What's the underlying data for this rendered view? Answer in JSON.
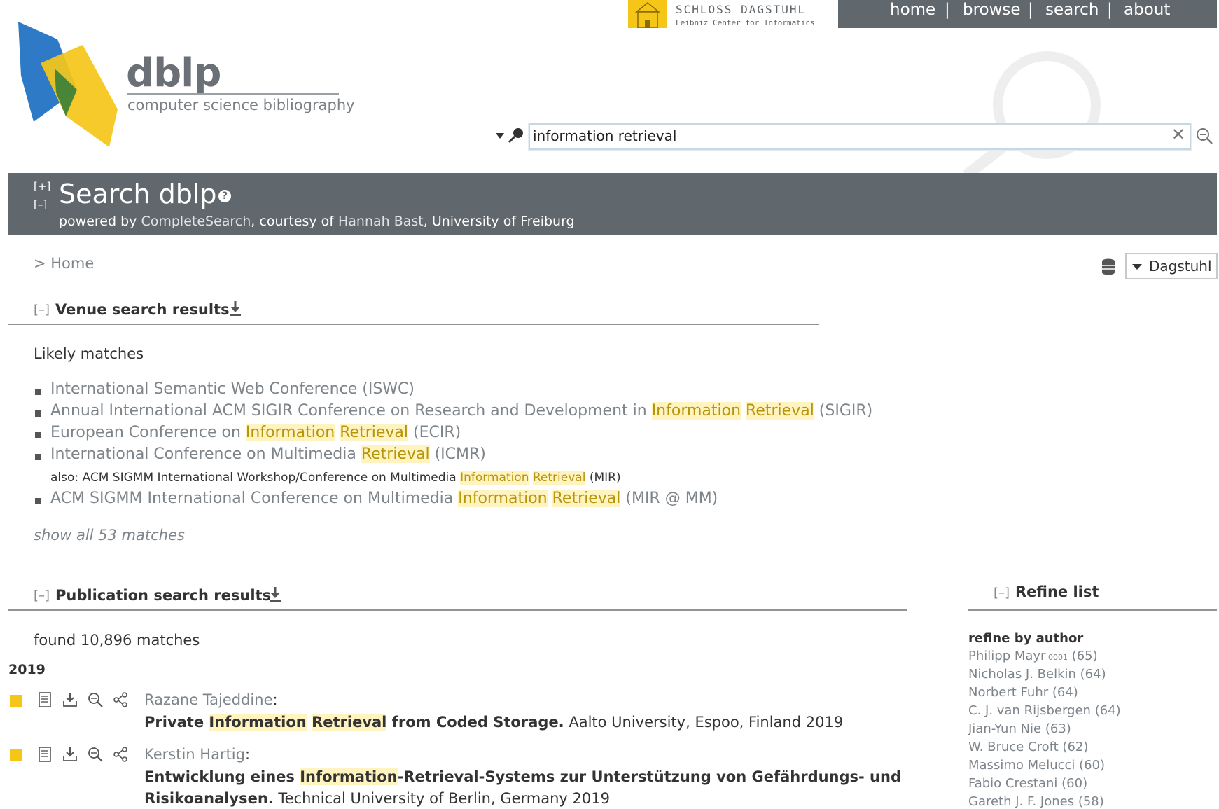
{
  "nav": {
    "home": "home",
    "browse": "browse",
    "search": "search",
    "about": "about",
    "sep": "|"
  },
  "dagstuhl": {
    "line1": "SCHLOSS DAGSTUHL",
    "line2": "Leibniz Center for Informatics"
  },
  "logo": {
    "name": "dblp",
    "tagline": "computer science bibliography"
  },
  "search": {
    "query": "information retrieval",
    "clear": "✕"
  },
  "header": {
    "expand": "[+]",
    "collapse": "[–]",
    "title": "Search dblp",
    "help": "?",
    "powered_by": "powered by ",
    "completesearch": "CompleteSearch",
    "courtesy": ", courtesy of ",
    "person": "Hannah Bast",
    "affiliation": ", University of Freiburg"
  },
  "breadcrumb": "> Home",
  "mirror": {
    "selected": "Dagstuhl"
  },
  "venue": {
    "toggle": "[–]",
    "title": "Venue search results",
    "likely": "Likely matches",
    "items": [
      {
        "parts": [
          {
            "t": "International Semantic Web Conference (ISWC)"
          }
        ]
      },
      {
        "parts": [
          {
            "t": "Annual International ACM SIGIR Conference on Research and Development in "
          },
          {
            "t": "Information",
            "h": true
          },
          {
            "t": " "
          },
          {
            "t": "Retrieval",
            "h": true
          },
          {
            "t": " (SIGIR)"
          }
        ]
      },
      {
        "parts": [
          {
            "t": "European Conference on "
          },
          {
            "t": "Information",
            "h": true
          },
          {
            "t": " "
          },
          {
            "t": "Retrieval",
            "h": true
          },
          {
            "t": " (ECIR)"
          }
        ]
      },
      {
        "parts": [
          {
            "t": "International Conference on Multimedia "
          },
          {
            "t": "Retrieval",
            "h": true
          },
          {
            "t": " (ICMR)"
          }
        ]
      },
      {
        "parts": [
          {
            "t": "ACM SIGMM International Conference on Multimedia "
          },
          {
            "t": "Information",
            "h": true
          },
          {
            "t": " "
          },
          {
            "t": "Retrieval",
            "h": true
          },
          {
            "t": " (MIR @ MM)"
          }
        ]
      }
    ],
    "also_parts": [
      {
        "t": "also: ACM SIGMM International Workshop/Conference on Multimedia "
      },
      {
        "t": "Information",
        "h": true
      },
      {
        "t": " "
      },
      {
        "t": "Retrieval",
        "h": true
      },
      {
        "t": " (MIR)"
      }
    ],
    "show_all": "show all 53 matches"
  },
  "pubs": {
    "toggle": "[–]",
    "title": "Publication search results",
    "found": "found 10,896 matches",
    "year": "2019",
    "items": [
      {
        "author": "Razane Tajeddine",
        "title_parts": [
          {
            "t": "Private "
          },
          {
            "t": "Information",
            "h": true
          },
          {
            "t": " "
          },
          {
            "t": "Retrieval",
            "h": true
          },
          {
            "t": " from Coded Storage."
          }
        ],
        "venue": " Aalto University, Espoo, Finland 2019"
      },
      {
        "author": "Kerstin Hartig",
        "title_parts": [
          {
            "t": "Entwicklung eines "
          },
          {
            "t": "Information",
            "h": true
          },
          {
            "t": "-Retrieval-Systems zur Unterstützung von Gefährdungs- und"
          }
        ],
        "title_line2": "Risikoanalysen.",
        "venue": " Technical University of Berlin, Germany 2019"
      }
    ]
  },
  "refine": {
    "toggle": "[–]",
    "title": "Refine list",
    "by_author": "refine by author",
    "authors": [
      {
        "name": "Philipp Mayr",
        "suffix": "0001",
        "count": "(65)"
      },
      {
        "name": "Nicholas J. Belkin",
        "count": "(64)"
      },
      {
        "name": "Norbert Fuhr",
        "count": "(64)"
      },
      {
        "name": "C. J. van Rijsbergen",
        "count": "(64)"
      },
      {
        "name": "Jian-Yun Nie",
        "count": "(63)"
      },
      {
        "name": "W. Bruce Croft",
        "count": "(62)"
      },
      {
        "name": "Massimo Melucci",
        "count": "(60)"
      },
      {
        "name": "Fabio Crestani",
        "count": "(60)"
      },
      {
        "name": "Gareth J. F. Jones",
        "count": "(58)"
      }
    ]
  },
  "colors": {
    "bar": "#60686d",
    "accent": "#f5c518",
    "highlight": "#fff3c0",
    "link": "#7d848a"
  }
}
